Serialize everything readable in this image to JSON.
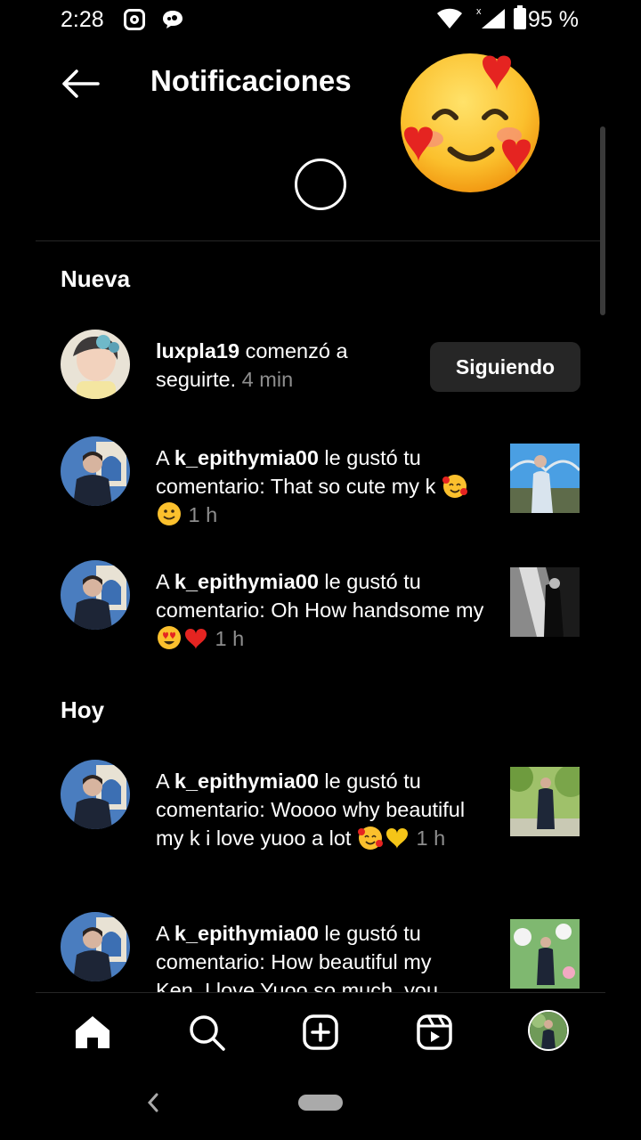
{
  "status_bar": {
    "time": "2:28",
    "battery": "95 %",
    "icons": [
      "instagram-icon",
      "message-icon",
      "wifi-icon",
      "signal-icon",
      "battery-icon"
    ]
  },
  "header": {
    "title": "Notificaciones",
    "back_icon": "arrow-left-icon"
  },
  "sections": {
    "new_title": "Nueva",
    "today_title": "Hoy"
  },
  "notifications": [
    {
      "user": "luxpla19",
      "text": " comenzó a seguirte.",
      "time": " 4 min",
      "button": "Siguiendo"
    },
    {
      "prefix": "A ",
      "user": "k_epithymia00",
      "text": " le gustó tu comentario: That so cute my k ",
      "emojis": [
        "smiling-face-with-hearts",
        "slightly-smiling-face"
      ],
      "time": " 1 h"
    },
    {
      "prefix": "A ",
      "user": "k_epithymia00",
      "text": " le gustó tu comentario: Oh How handsome my ",
      "emojis": [
        "heart-eyes-face",
        "red-heart"
      ],
      "time": " 1 h"
    },
    {
      "prefix": "A ",
      "user": "k_epithymia00",
      "text": " le gustó tu comentario: Woooo why beautiful my k i love yuoo a lot ",
      "emojis": [
        "smiling-face-with-hearts",
        "yellow-heart"
      ],
      "time": " 1 h"
    },
    {
      "prefix": "A ",
      "user": "k_epithymia00",
      "text": " le gustó tu comentario: How beautiful my Ken. I love Yuoo so much, you"
    }
  ],
  "nav": [
    "home-icon",
    "search-icon",
    "create-icon",
    "reels-icon",
    "profile-avatar"
  ],
  "colors": {
    "background": "#000000",
    "muted": "#8e8e8e",
    "button": "#262626"
  }
}
